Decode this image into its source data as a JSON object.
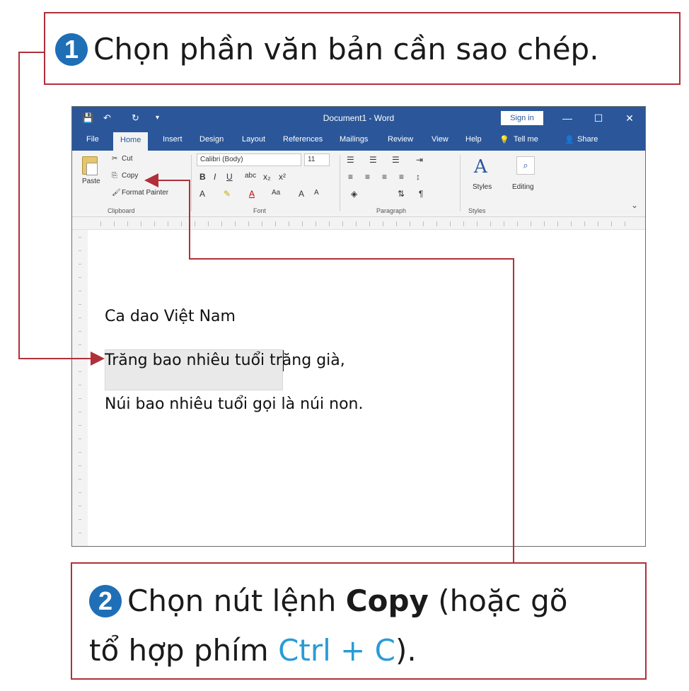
{
  "callout1": {
    "number": "1",
    "text": "Chọn phần văn bản cần sao chép."
  },
  "callout2": {
    "number": "2",
    "text_prefix": "Chọn nút lệnh ",
    "text_bold": "Copy",
    "text_suffix": " (hoặc gõ",
    "line2_prefix": "tổ hợp phím ",
    "line2_accent": "Ctrl + C",
    "line2_suffix": ")."
  },
  "word": {
    "title": "Document1  -  Word",
    "signin": "Sign in",
    "quick_access": {
      "save": "💾",
      "undo": "↶",
      "redo": "↻"
    },
    "window_buttons": {
      "minimize": "—",
      "maximize": "☐",
      "close": "✕"
    },
    "tabs": [
      "File",
      "Home",
      "Insert",
      "Design",
      "Layout",
      "References",
      "Mailings",
      "Review",
      "View",
      "Help"
    ],
    "tell_me": "Tell me",
    "share": "Share",
    "ribbon": {
      "clipboard": {
        "paste": "Paste",
        "cut": "Cut",
        "copy": "Copy",
        "format_painter": "Format Painter",
        "label": "Clipboard"
      },
      "font": {
        "font_name": "Calibri (Body)",
        "font_size": "11",
        "label": "Font"
      },
      "paragraph": {
        "label": "Paragraph"
      },
      "styles": {
        "button": "Styles",
        "label": "Styles"
      },
      "editing": {
        "button": "Editing"
      }
    },
    "document": {
      "heading": "Ca dao Việt Nam",
      "line1": "Trăng bao nhiêu tuổi trăng già,",
      "line2": "Núi bao nhiêu tuổi gọi là núi non."
    }
  },
  "colors": {
    "word_blue": "#2b579a",
    "callout_border": "#b0303a",
    "step_number": "#1f6fb6",
    "accent_text": "#2a9bd6",
    "arrow": "#b0303a"
  }
}
